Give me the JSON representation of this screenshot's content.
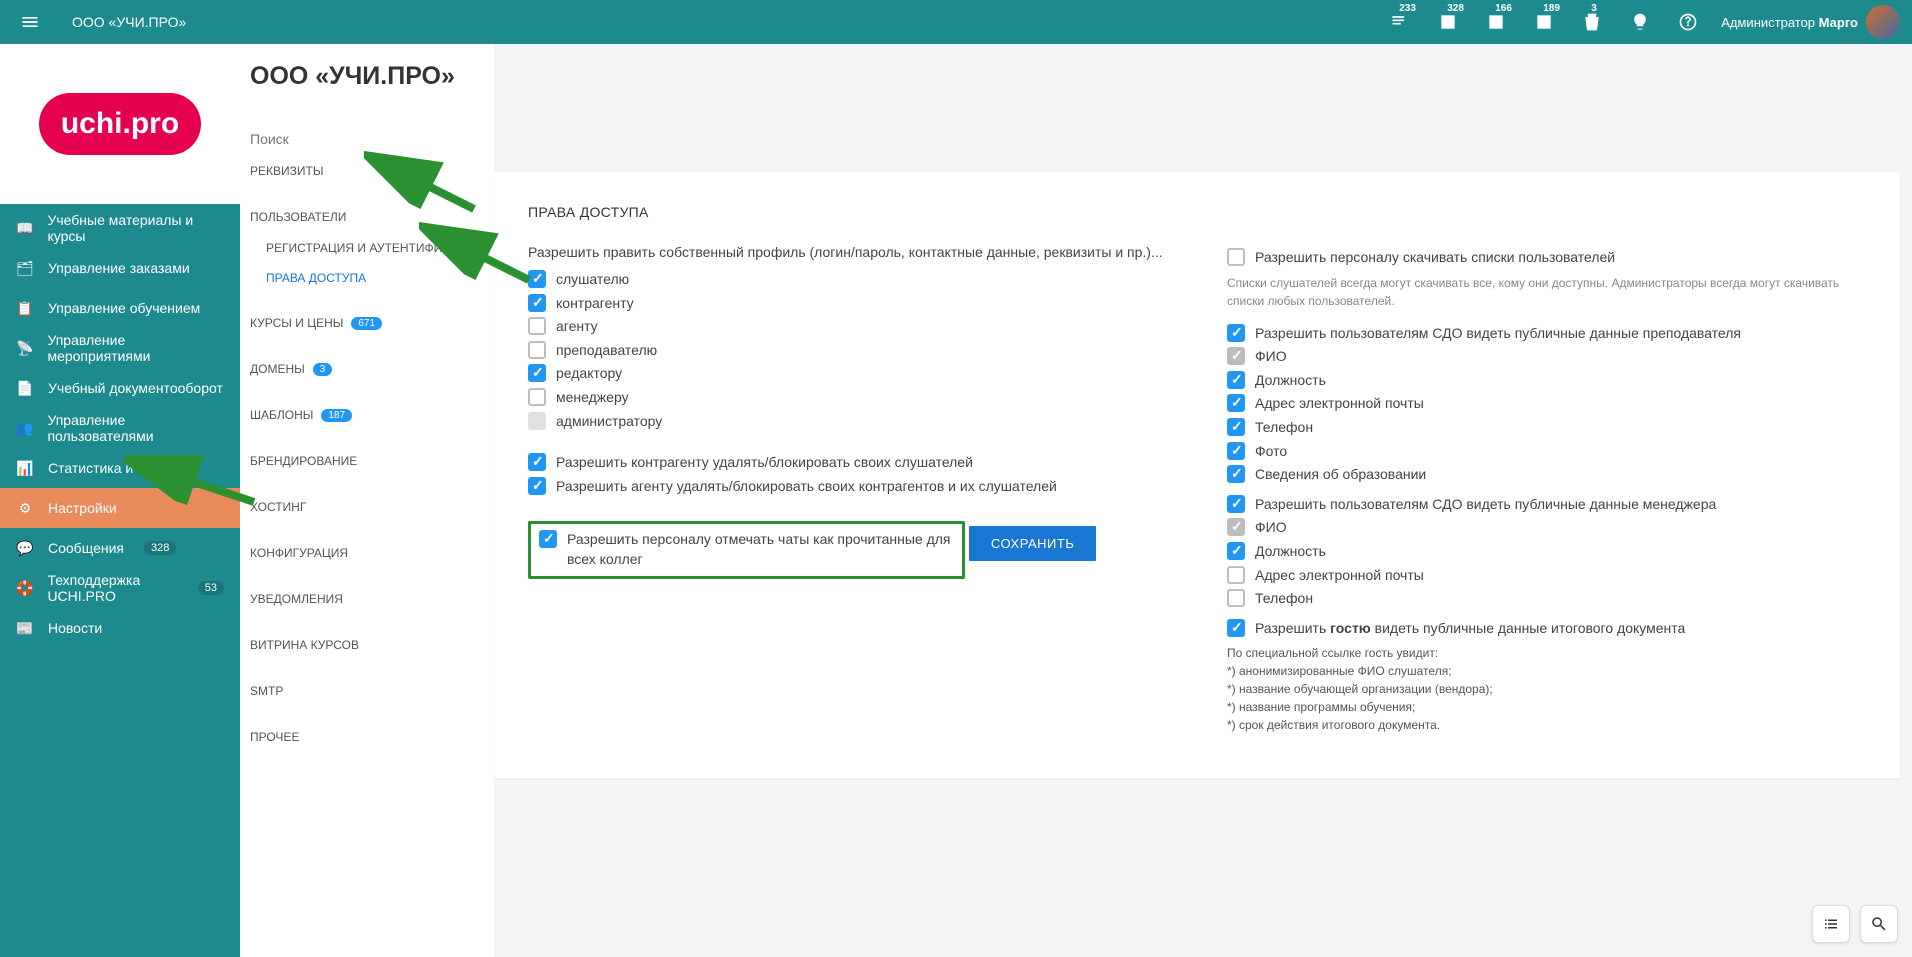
{
  "topbar": {
    "org_title": "ООО «УЧИ.ПРО»",
    "counts": [
      "233",
      "328",
      "166",
      "189",
      "3"
    ],
    "user_prefix": "Администратор",
    "user_name": "Марго"
  },
  "sidebar": {
    "logo_text": "uchi.pro",
    "items": [
      {
        "label": "Учебные материалы и курсы"
      },
      {
        "label": "Управление заказами"
      },
      {
        "label": "Управление обучением"
      },
      {
        "label": "Управление мероприятиями"
      },
      {
        "label": "Учебный документооборот"
      },
      {
        "label": "Управление пользователями"
      },
      {
        "label": "Статистика и отчёты"
      },
      {
        "label": "Настройки"
      },
      {
        "label": "Сообщения",
        "badge": "328"
      },
      {
        "label": "Техподдержка UCHI.PRO",
        "badge": "53"
      },
      {
        "label": "Новости"
      }
    ]
  },
  "subpanel": {
    "title": "ООО «УЧИ.ПРО»",
    "search_placeholder": "Поиск",
    "items": [
      {
        "label": "РЕКВИЗИТЫ"
      },
      {
        "label": "ПОЛЬЗОВАТЕЛИ"
      },
      {
        "label": "РЕГИСТРАЦИЯ И АУТЕНТИФИКАЦИЯ",
        "sub": true
      },
      {
        "label": "ПРАВА ДОСТУПА",
        "sub": true,
        "active": true
      },
      {
        "label": "КУРСЫ И ЦЕНЫ",
        "badge": "671"
      },
      {
        "label": "ДОМЕНЫ",
        "badge": "3"
      },
      {
        "label": "ШАБЛОНЫ",
        "badge": "187"
      },
      {
        "label": "БРЕНДИРОВАНИЕ"
      },
      {
        "label": "ХОСТИНГ"
      },
      {
        "label": "КОНФИГУРАЦИЯ"
      },
      {
        "label": "УВЕДОМЛЕНИЯ"
      },
      {
        "label": "ВИТРИНА КУРСОВ"
      },
      {
        "label": "SMTP"
      },
      {
        "label": "ПРОЧЕЕ"
      }
    ]
  },
  "content": {
    "heading": "ПРАВА ДОСТУПА",
    "profile_perm_text": "Разрешить править собственный профиль (логин/пароль, контактные данные, реквизиты и пр.)...",
    "roles": [
      {
        "label": "слушателю",
        "checked": true
      },
      {
        "label": "контрагенту",
        "checked": true
      },
      {
        "label": "агенту",
        "checked": false
      },
      {
        "label": "преподавателю",
        "checked": false
      },
      {
        "label": "редактору",
        "checked": true
      },
      {
        "label": "менеджеру",
        "checked": false
      },
      {
        "label": "администратору",
        "checked": false,
        "disabled": true
      }
    ],
    "perm_contr_delete": "Разрешить контрагенту удалять/блокировать своих слушателей",
    "perm_agent_delete": "Разрешить агенту удалять/блокировать своих контрагентов и их слушателей",
    "perm_personnel_chats": "Разрешить персоналу отмечать чаты как прочитанные для всех коллег",
    "perm_download_lists": "Разрешить персоналу скачивать списки пользователей",
    "download_hint": "Списки слушателей всегда могут скачивать все, кому они доступны. Администраторы всегда могут скачивать списки любых пользователей.",
    "perm_teacher_public": "Разрешить пользователям СДО видеть публичные данные преподавателя",
    "teacher_fields": [
      {
        "label": "ФИО",
        "checked": true,
        "disabled": true
      },
      {
        "label": "Должность",
        "checked": true
      },
      {
        "label": "Адрес электронной почты",
        "checked": true
      },
      {
        "label": "Телефон",
        "checked": true
      },
      {
        "label": "Фото",
        "checked": true
      },
      {
        "label": "Сведения об образовании",
        "checked": true
      }
    ],
    "perm_manager_public": "Разрешить пользователям СДО видеть публичные данные менеджера",
    "manager_fields": [
      {
        "label": "ФИО",
        "checked": true,
        "disabled": true
      },
      {
        "label": "Должность",
        "checked": true
      },
      {
        "label": "Адрес электронной почты",
        "checked": false
      },
      {
        "label": "Телефон",
        "checked": false
      }
    ],
    "perm_guest_pre": "Разрешить ",
    "perm_guest_bold": "гостю",
    "perm_guest_post": " видеть публичные данные итогового документа",
    "guest_hint_title": "По специальной ссылке гость увидит:",
    "guest_hints": [
      "*)  анонимизированные ФИО слушателя;",
      "*)  название обучающей организации (вендора);",
      "*)  название программы обучения;",
      "*)  срок действия итогового документа."
    ],
    "save": "СОХРАНИТЬ"
  }
}
